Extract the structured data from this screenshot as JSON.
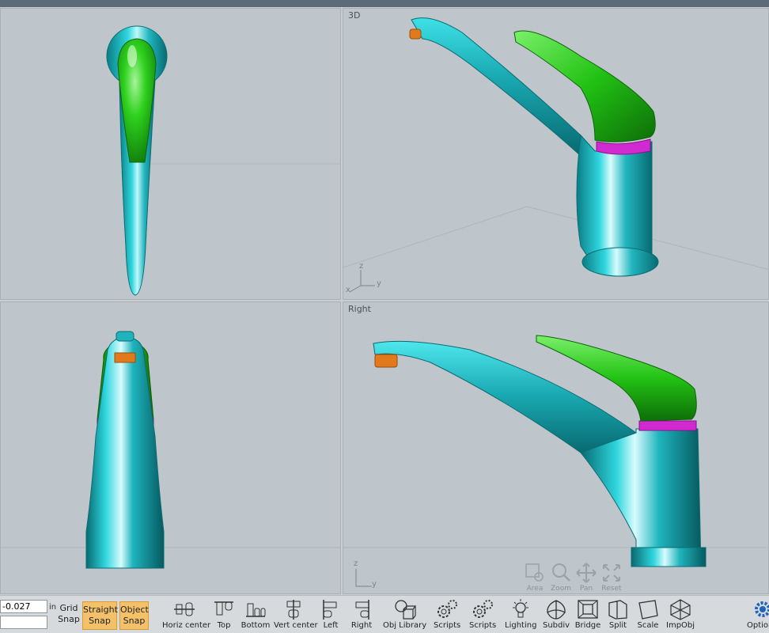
{
  "viewports": {
    "top_left": {
      "label": ""
    },
    "top_right": {
      "label": "3D"
    },
    "bottom_left": {
      "label": ""
    },
    "bottom_right": {
      "label": "Right"
    }
  },
  "axes": {
    "z": "z",
    "x": "x",
    "y": "y"
  },
  "view_nav": [
    {
      "label": "Area",
      "icon": "area-zoom-icon"
    },
    {
      "label": "Zoom",
      "icon": "magnifier-icon"
    },
    {
      "label": "Pan",
      "icon": "pan-arrows-icon"
    },
    {
      "label": "Reset",
      "icon": "reset-view-icon"
    }
  ],
  "coords": {
    "value": "-0.027",
    "unit": "in",
    "second_value": ""
  },
  "grid_snap": {
    "line1": "Grid",
    "line2": "Snap"
  },
  "straight_snap": {
    "line1": "Straight",
    "line2": "Snap",
    "color": "#f3c169"
  },
  "object_snap": {
    "line1": "Object",
    "line2": "Snap",
    "color": "#f3c169"
  },
  "tools": [
    {
      "label": "Horiz center",
      "icon": "horiz-center-icon"
    },
    {
      "label": "Top",
      "icon": "align-top-icon"
    },
    {
      "label": "Bottom",
      "icon": "align-bottom-icon"
    },
    {
      "label": "Vert center",
      "icon": "vert-center-icon"
    },
    {
      "label": "Left",
      "icon": "align-left-icon"
    },
    {
      "label": "Right",
      "icon": "align-right-icon"
    },
    {
      "label": "Obj Library",
      "icon": "object-library-icon"
    },
    {
      "label": "Scripts",
      "icon": "gears-icon"
    },
    {
      "label": "Scripts",
      "icon": "gears-icon"
    },
    {
      "label": "Lighting",
      "icon": "lightbulb-icon"
    },
    {
      "label": "Subdiv",
      "icon": "subdivide-icon"
    },
    {
      "label": "Bridge",
      "icon": "bridge-icon"
    },
    {
      "label": "Split",
      "icon": "split-icon"
    },
    {
      "label": "Scale",
      "icon": "scale-icon"
    },
    {
      "label": "ImpObj",
      "icon": "import-object-icon"
    }
  ],
  "options": {
    "label": "Options",
    "icon": "gear-icon"
  },
  "colors": {
    "body": "#1fb4bd",
    "handle": "#22b81a",
    "ring": "#d02ad0",
    "aerator": "#e07a1c",
    "viewport_bg": "#bec5cb",
    "snap_active": "#f3c169"
  }
}
